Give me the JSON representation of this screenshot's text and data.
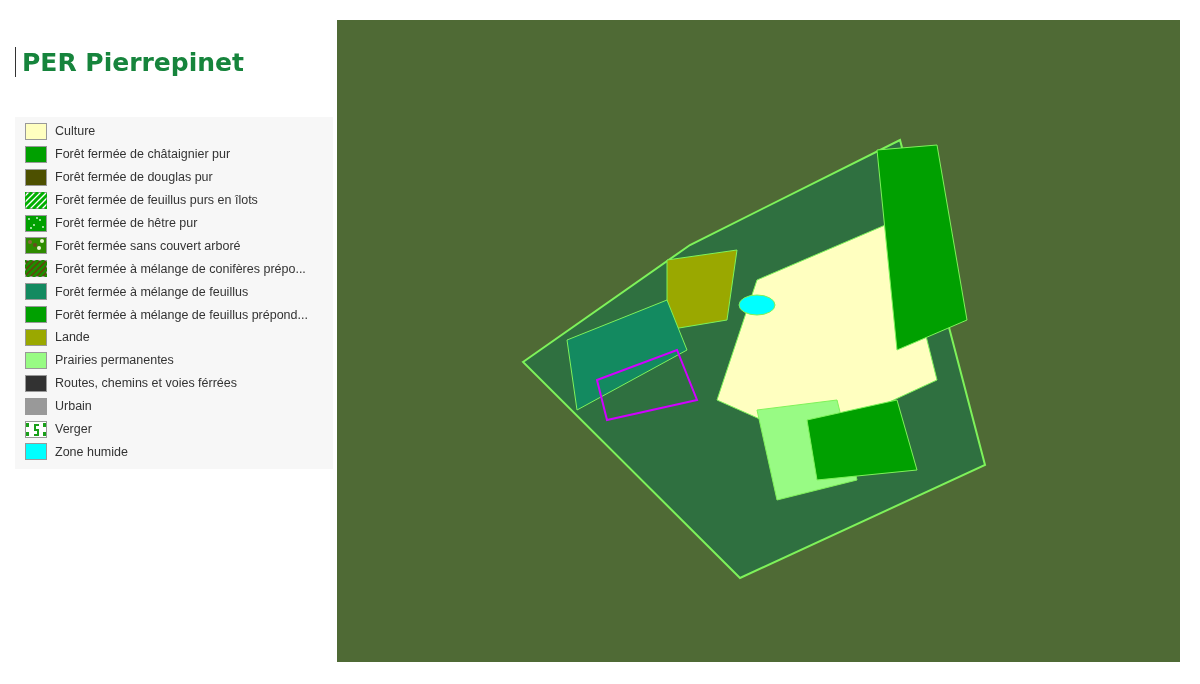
{
  "title": "PER Pierrepinet",
  "legend": [
    {
      "label": "Culture",
      "kind": "solid",
      "color": "#ffffc0"
    },
    {
      "label": "Forêt fermée de châtaignier pur",
      "kind": "solid",
      "color": "#00a000"
    },
    {
      "label": "Forêt fermée de douglas pur",
      "kind": "solid",
      "color": "#4d5000"
    },
    {
      "label": "Forêt fermée de feuillus purs en îlots",
      "kind": "hatch",
      "color": "#00b000"
    },
    {
      "label": "Forêt fermée de hêtre pur",
      "kind": "speckle",
      "color": "#00a000"
    },
    {
      "label": "Forêt fermée sans couvert arboré",
      "kind": "mottled",
      "color": "#2e8b00"
    },
    {
      "label": "Forêt fermée à mélange de conifères prépo...",
      "kind": "twotone",
      "color": "#1e8c00"
    },
    {
      "label": "Forêt fermée à mélange de feuillus",
      "kind": "solid",
      "color": "#138a60"
    },
    {
      "label": "Forêt fermée à mélange de feuillus prépond...",
      "kind": "solid",
      "color": "#00a000"
    },
    {
      "label": "Lande",
      "kind": "solid",
      "color": "#9aa800"
    },
    {
      "label": "Prairies permanentes",
      "kind": "solid",
      "color": "#98fb84"
    },
    {
      "label": "Routes, chemins et voies férrées",
      "kind": "solid",
      "color": "#323232"
    },
    {
      "label": "Urbain",
      "kind": "solid",
      "color": "#999999"
    },
    {
      "label": "Verger",
      "kind": "orchard",
      "color": "#1aa01a"
    },
    {
      "label": "Zone humide",
      "kind": "solid",
      "color": "#00ffff"
    }
  ]
}
